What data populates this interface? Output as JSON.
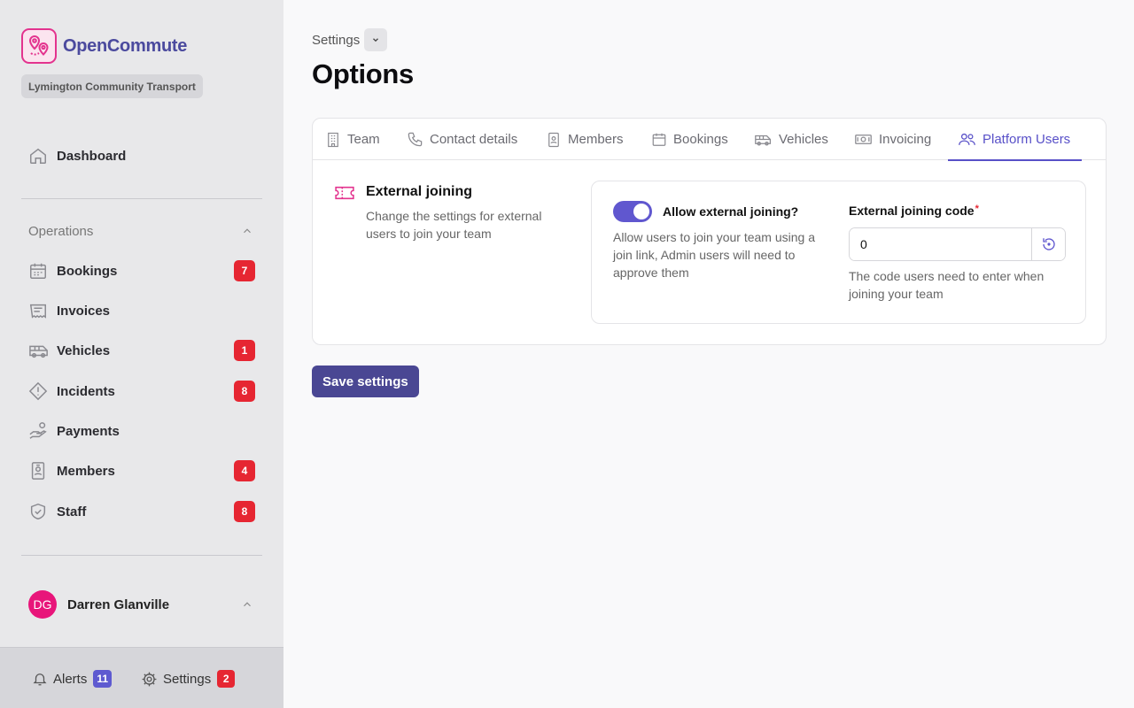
{
  "app": {
    "name": "OpenCommute",
    "organisation": "Lymington Community Transport",
    "logo_icon": "map-pin-icon"
  },
  "sidebar": {
    "dashboard": {
      "label": "Dashboard",
      "icon": "home-icon"
    },
    "section": {
      "label": "Operations",
      "collapsed": false
    },
    "items": [
      {
        "label": "Bookings",
        "icon": "calendar-icon",
        "badge": "7"
      },
      {
        "label": "Invoices",
        "icon": "receipt-icon",
        "badge": ""
      },
      {
        "label": "Vehicles",
        "icon": "bus-icon",
        "badge": "1"
      },
      {
        "label": "Incidents",
        "icon": "warning-icon",
        "badge": "8"
      },
      {
        "label": "Payments",
        "icon": "hand-coins-icon",
        "badge": ""
      },
      {
        "label": "Members",
        "icon": "id-badge-icon",
        "badge": "4"
      },
      {
        "label": "Staff",
        "icon": "shield-check-icon",
        "badge": "8"
      }
    ],
    "user": {
      "initials": "DG",
      "name": "Darren Glanville"
    },
    "footer": {
      "alerts": {
        "label": "Alerts",
        "count": "11",
        "color": "#5e5ad0"
      },
      "settings": {
        "label": "Settings",
        "count": "2",
        "color": "#e62632"
      }
    }
  },
  "main": {
    "breadcrumb": "Settings",
    "title": "Options",
    "tabs": [
      {
        "label": "Team",
        "icon": "building-icon",
        "active": false
      },
      {
        "label": "Contact details",
        "icon": "phone-icon",
        "active": false
      },
      {
        "label": "Members",
        "icon": "id-badge-icon",
        "active": false
      },
      {
        "label": "Bookings",
        "icon": "calendar-icon",
        "active": false
      },
      {
        "label": "Vehicles",
        "icon": "bus-icon",
        "active": false
      },
      {
        "label": "Invoicing",
        "icon": "banknote-icon",
        "active": false
      },
      {
        "label": "Platform Users",
        "icon": "users-icon",
        "active": true
      }
    ],
    "section": {
      "title": "External joining",
      "description": "Change the settings for external users to join your team",
      "icon": "ticket-icon"
    },
    "toggle": {
      "label": "Allow external joining?",
      "enabled": true,
      "description": "Allow users to join your team using a join link, Admin users will need to approve them"
    },
    "code": {
      "label": "External joining code",
      "required_mark": "*",
      "value": "0",
      "help": "The code users need to enter when joining your team"
    },
    "save_label": "Save settings"
  },
  "colors": {
    "accent": "#5850c8",
    "brand": "#4b4a9e",
    "brand_pink": "#e3338e",
    "badge_red": "#e62632",
    "primary_button": "#4a4793"
  }
}
